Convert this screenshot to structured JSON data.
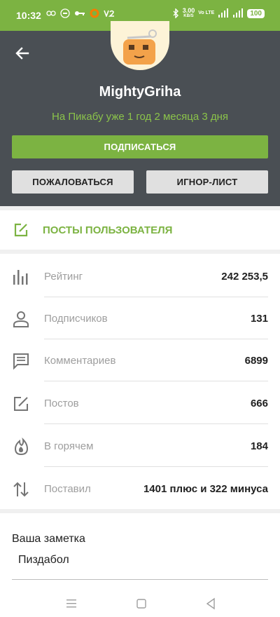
{
  "status": {
    "time": "10:32",
    "speed_value": "3.00",
    "speed_unit": "KB/S",
    "network": "Vo LTE",
    "battery": "100"
  },
  "profile": {
    "username": "MightyGriha",
    "since": "На Пикабу уже 1 год 2 месяца 3 дня"
  },
  "actions": {
    "subscribe": "ПОДПИСАТЬСЯ",
    "report": "ПОЖАЛОВАТЬСЯ",
    "ignore": "ИГНОР-ЛИСТ"
  },
  "posts_link": {
    "label": "ПОСТЫ ПОЛЬЗОВАТЕЛЯ"
  },
  "stats": [
    {
      "label": "Рейтинг",
      "value": "242 253,5",
      "icon": "bar-chart-icon"
    },
    {
      "label": "Подписчиков",
      "value": "131",
      "icon": "person-icon"
    },
    {
      "label": "Комментариев",
      "value": "6899",
      "icon": "comment-icon"
    },
    {
      "label": "Постов",
      "value": "666",
      "icon": "edit-icon"
    },
    {
      "label": "В горячем",
      "value": "184",
      "icon": "flame-icon"
    },
    {
      "label": "Поставил",
      "value": "1401 плюс и 322 минуса",
      "icon": "swap-vertical-icon"
    }
  ],
  "note": {
    "title": "Ваша заметка",
    "value": "Пиздабол"
  },
  "colors": {
    "accent": "#7cb342",
    "header_bg": "#4a4f54"
  }
}
